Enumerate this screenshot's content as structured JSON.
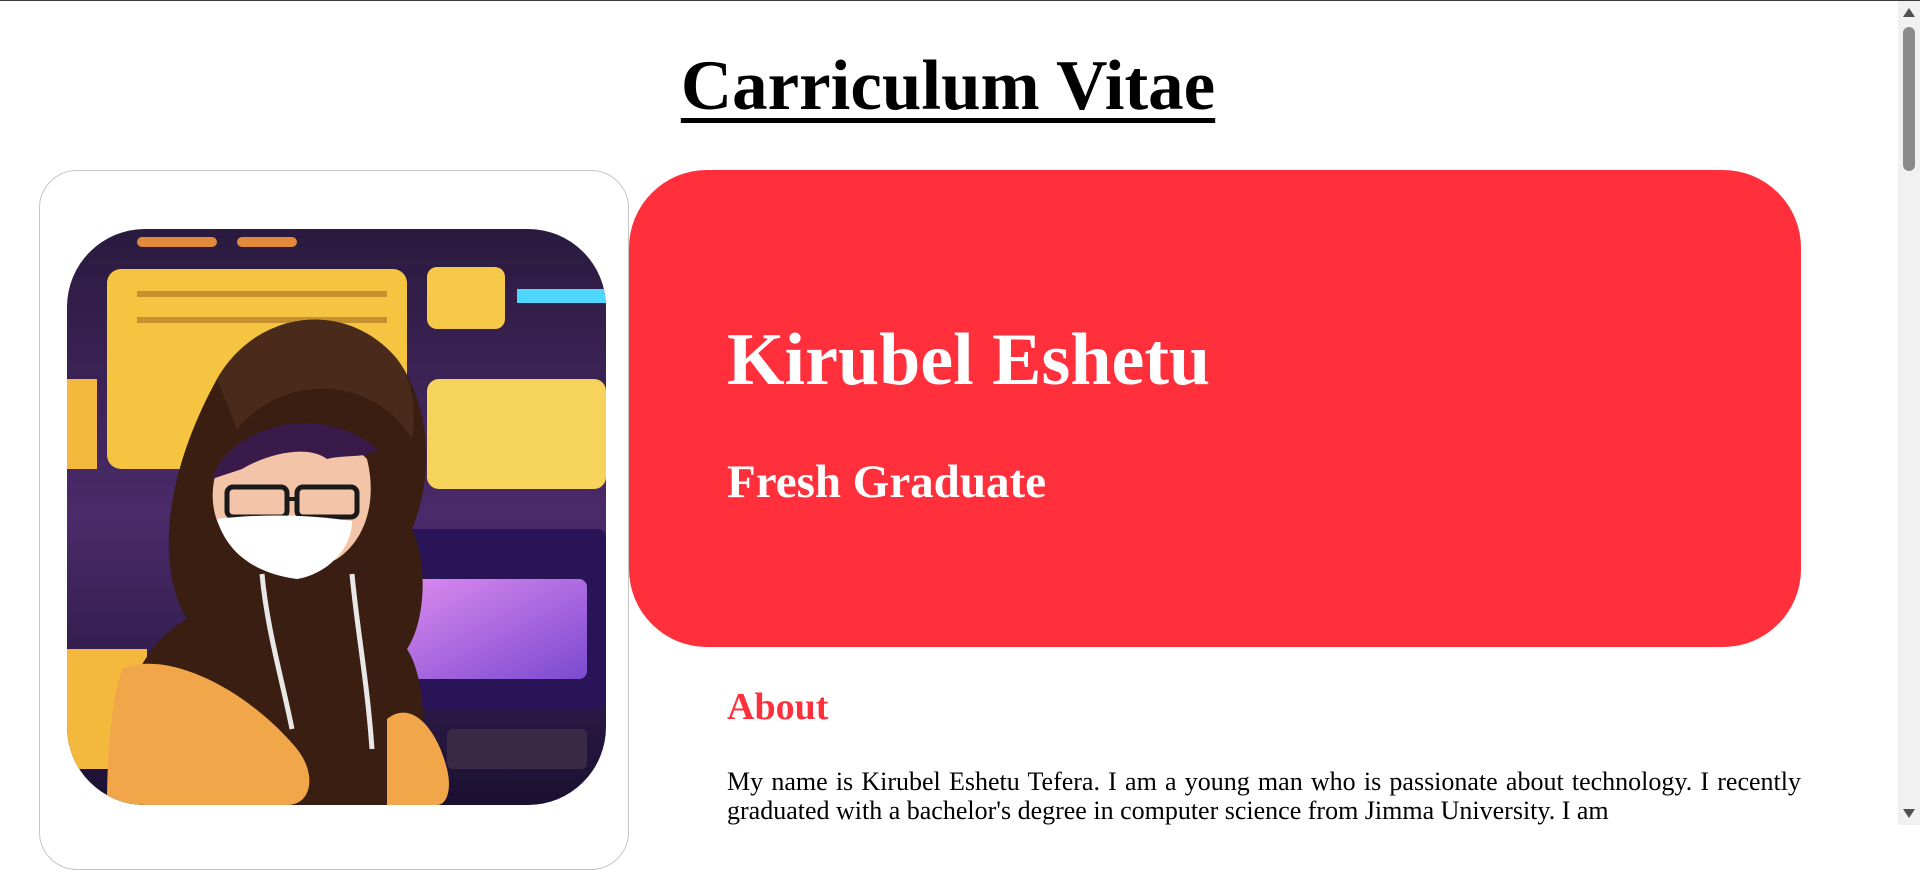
{
  "page": {
    "title": "Carriculum Vitae"
  },
  "profile": {
    "avatar_alt": "avatar"
  },
  "hero": {
    "name": "Kirubel Eshetu",
    "role": "Fresh Graduate",
    "background_color": "#ff303c"
  },
  "about": {
    "heading": "About",
    "text": "My name is Kirubel Eshetu Tefera. I am a young man who is passionate about technology. I recently graduated with a bachelor's degree in computer science from Jimma University. I am"
  },
  "colors": {
    "accent": "#ff303c",
    "text": "#000000",
    "background": "#ffffff"
  },
  "icons": {
    "scroll_up": "scroll-up-arrow-icon",
    "scroll_down": "scroll-down-arrow-icon"
  }
}
